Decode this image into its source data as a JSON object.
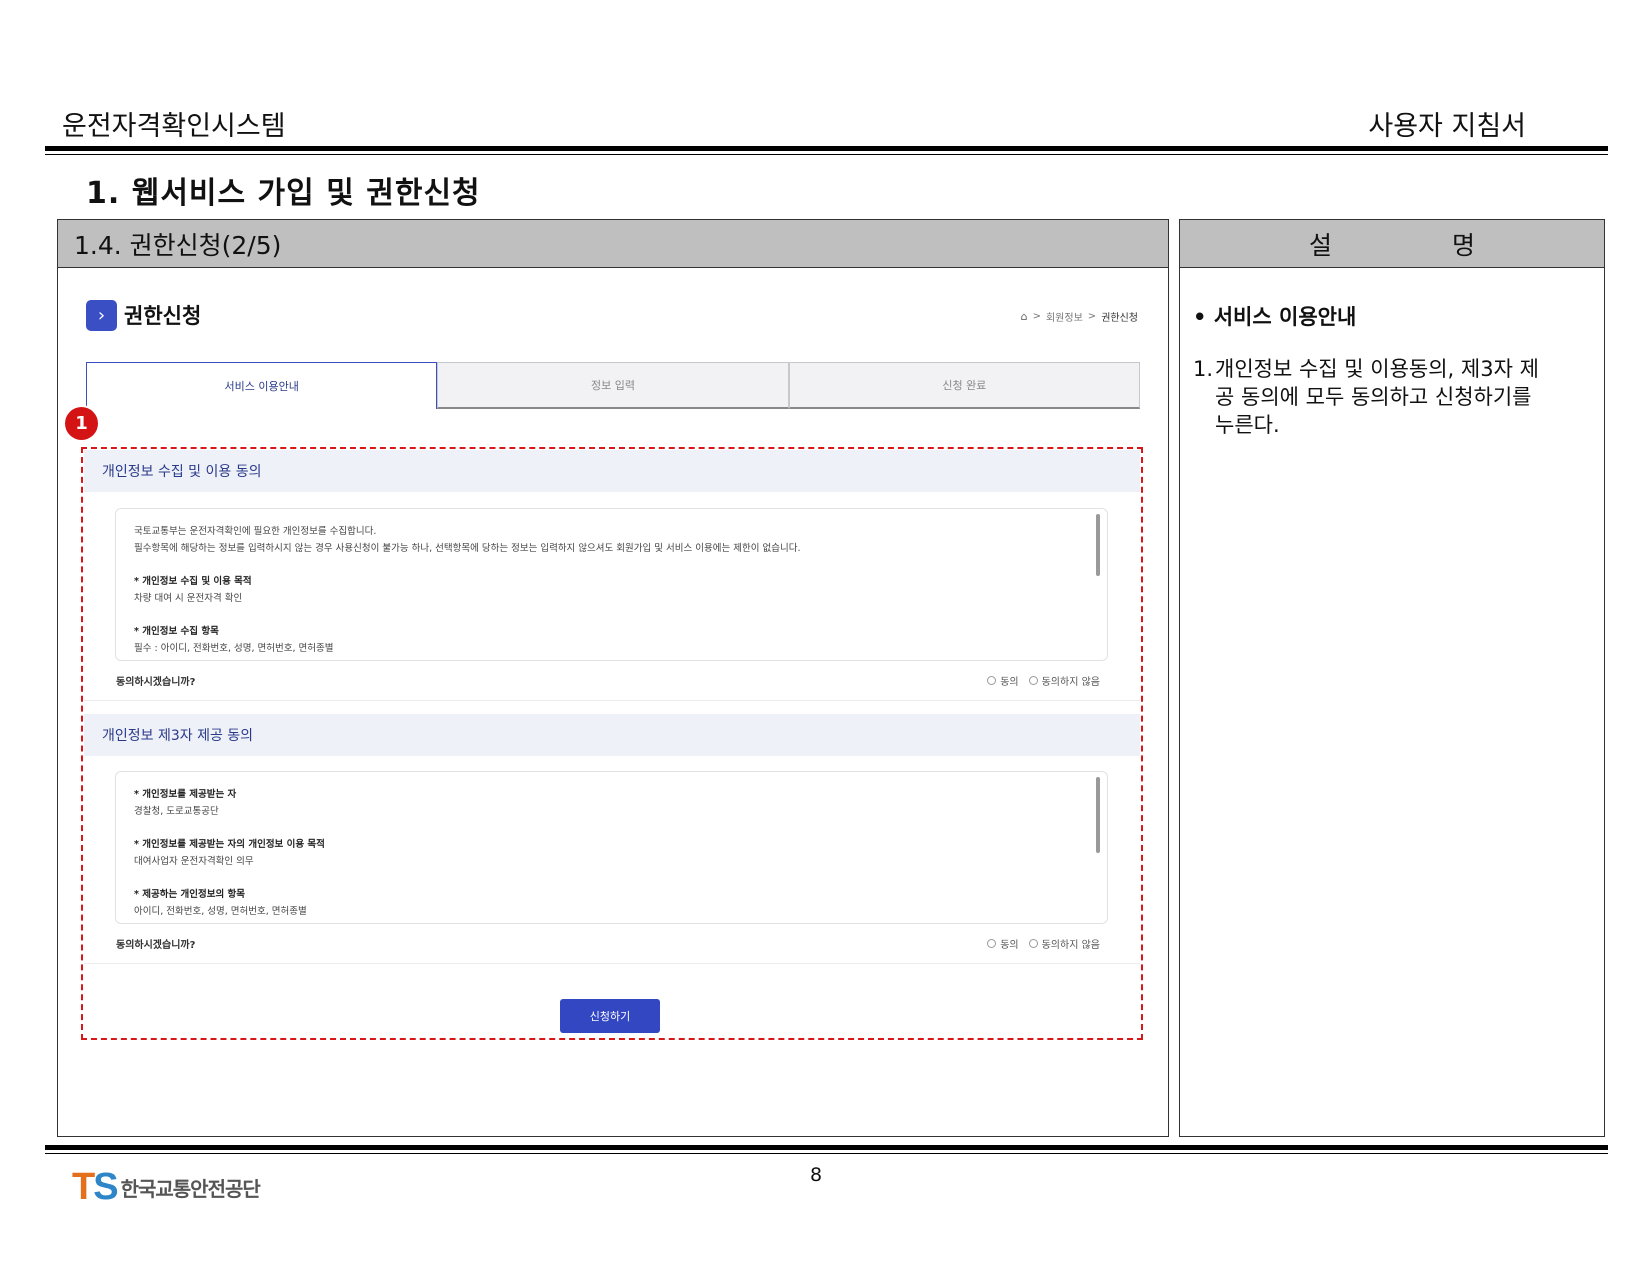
{
  "header": {
    "system_name": "운전자격확인시스템",
    "doc_type": "사용자 지침서"
  },
  "section_heading": "1. 웹서비스 가입 및 권한신청",
  "left_panel": {
    "title": "1.4. 권한신청(2/5)"
  },
  "right_panel": {
    "title_a": "설",
    "title_b": "명",
    "bullet": "• 서비스 이용안내",
    "item_num": "1.",
    "item_line1": "개인정보 수집 및 이용동의, 제3자 제",
    "item_line2": "공 동의에 모두 동의하고 신청하기를",
    "item_line3": "누른다."
  },
  "screenshot": {
    "page_title": "권한신청",
    "title_icon": "chevron-right-icon",
    "breadcrumb": {
      "home_icon": "home-icon",
      "sep": ">",
      "level1": "회원정보",
      "level2": "권한신청"
    },
    "tabs": [
      "서비스 이용안내",
      "정보 입력",
      "신청 완료"
    ],
    "marker": "1",
    "sections": [
      {
        "heading": "개인정보 수집 및 이용 동의",
        "lines": [
          "국토교통부는 운전자격확인에 필요한 개인정보를 수집합니다.",
          "필수항목에 해당하는 정보를 입력하시지 않는 경우 사용신청이 불가능 하나, 선택항목에 당하는 정보는 입력하지 않으셔도 회원가입 및 서비스 이용에는 제한이 없습니다.",
          "* 개인정보 수집 및 이용 목적",
          "차량 대여 시 운전자격 확인",
          "* 개인정보 수집 항목",
          "필수 : 아이디, 전화번호, 성명, 면허번호, 면허종별"
        ],
        "question": "동의하시겠습니까?",
        "agree": "동의",
        "disagree": "동의하지 않음"
      },
      {
        "heading": "개인정보 제3자 제공 동의",
        "lines": [
          "* 개인정보를 제공받는 자",
          "경찰청, 도로교통공단",
          "* 개인정보를 제공받는 자의 개인정보 이용 목적",
          "대여사업자 운전자격확인 의무",
          "* 제공하는 개인정보의 항목",
          "아이디, 전화번호, 성명, 면허번호, 면허종별"
        ],
        "question": "동의하시겠습니까?",
        "agree": "동의",
        "disagree": "동의하지 않음"
      }
    ],
    "apply_button": "신청하기"
  },
  "footer": {
    "page_number": "8",
    "logo_t": "T",
    "logo_s": "S",
    "org_name": "한국교통안전공단"
  }
}
